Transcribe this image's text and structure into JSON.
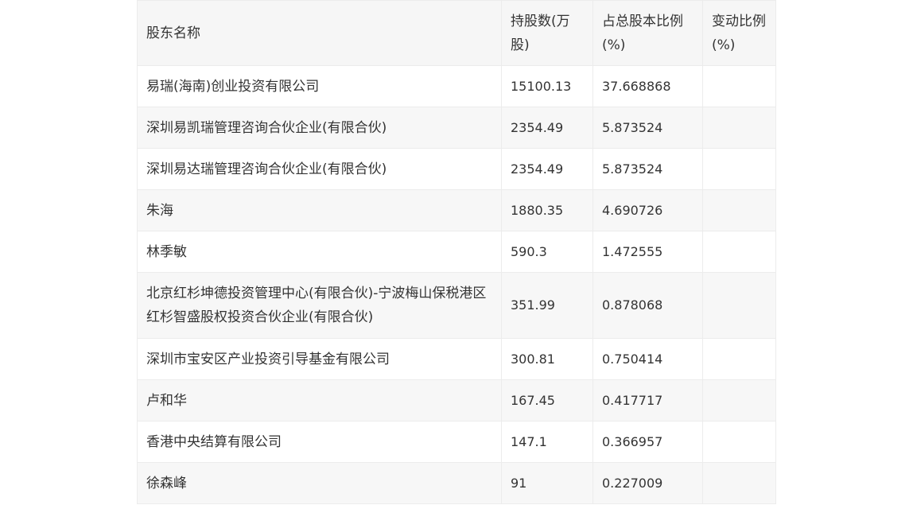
{
  "table": {
    "headers": [
      "股东名称",
      "持股数(万股)",
      "占总股本比例(%)",
      "变动比例(%)"
    ],
    "rows": [
      {
        "name": "易瑞(海南)创业投资有限公司",
        "shares": "15100.13",
        "ratio": "37.668868",
        "change": ""
      },
      {
        "name": "深圳易凯瑞管理咨询合伙企业(有限合伙)",
        "shares": "2354.49",
        "ratio": "5.873524",
        "change": ""
      },
      {
        "name": "深圳易达瑞管理咨询合伙企业(有限合伙)",
        "shares": "2354.49",
        "ratio": "5.873524",
        "change": ""
      },
      {
        "name": "朱海",
        "shares": "1880.35",
        "ratio": "4.690726",
        "change": ""
      },
      {
        "name": "林季敏",
        "shares": "590.3",
        "ratio": "1.472555",
        "change": ""
      },
      {
        "name": "北京红杉坤德投资管理中心(有限合伙)-宁波梅山保税港区红杉智盛股权投资合伙企业(有限合伙)",
        "shares": "351.99",
        "ratio": "0.878068",
        "change": ""
      },
      {
        "name": "深圳市宝安区产业投资引导基金有限公司",
        "shares": "300.81",
        "ratio": "0.750414",
        "change": ""
      },
      {
        "name": "卢和华",
        "shares": "167.45",
        "ratio": "0.417717",
        "change": ""
      },
      {
        "name": "香港中央结算有限公司",
        "shares": "147.1",
        "ratio": "0.366957",
        "change": ""
      },
      {
        "name": "徐森峰",
        "shares": "91",
        "ratio": "0.227009",
        "change": ""
      }
    ]
  }
}
